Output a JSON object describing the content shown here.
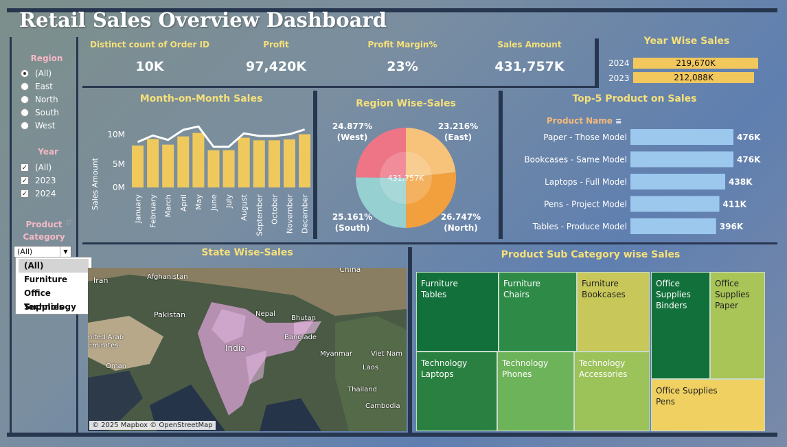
{
  "title": "Retail Sales Overview Dashboard",
  "filters": {
    "region": {
      "title": "Region",
      "options": [
        "(All)",
        "East",
        "North",
        "South",
        "West"
      ],
      "selected": "(All)"
    },
    "year": {
      "title": "Year",
      "options": [
        "(All)",
        "2023",
        "2024"
      ]
    },
    "product_category": {
      "title_line1": "Product",
      "title_line2": "Category",
      "value": "(All)",
      "options": [
        "(All)",
        "Furniture",
        "Office Supplies",
        "Technology"
      ]
    }
  },
  "kpis": [
    {
      "label": "Distinct count of Order ID",
      "value": "10K"
    },
    {
      "label": "Profit",
      "value": "97,420K"
    },
    {
      "label": "Profit Margin%",
      "value": "23%"
    },
    {
      "label": "Sales Amount",
      "value": "431,757K"
    }
  ],
  "year_wise_sales": {
    "title": "Year Wise Sales",
    "rows": [
      {
        "year": "2024",
        "label": "219,670K",
        "value": 219670
      },
      {
        "year": "2023",
        "label": "212,088K",
        "value": 212088
      }
    ]
  },
  "month_sales": {
    "title": "Month-on-Month Sales",
    "ylabel": "Sales Amount",
    "yticks": [
      "10M",
      "5M",
      "0M"
    ]
  },
  "region_sales": {
    "title": "Region Wise-Sales",
    "center": "431,757K",
    "labels": {
      "west_pct": "24.877%",
      "west": "(West)",
      "east_pct": "23.216%",
      "east": "(East)",
      "south_pct": "25.161%",
      "south": "(South)",
      "north_pct": "26.747%",
      "north": "(North)"
    }
  },
  "top5": {
    "title": "Top-5 Product on Sales",
    "header": "Product Name"
  },
  "state_sales": {
    "title": "State Wise-Sales",
    "credit": "© 2025 Mapbox © OpenStreetMap",
    "places": {
      "china": "China",
      "iran": "Iran",
      "afghanistan": "Afghanistan",
      "pakistan": "Pakistan",
      "nepal": "Nepal",
      "bhutan": "Bhutan",
      "india": "India",
      "bangladesh": "Banglade",
      "uae1": "nited Arab",
      "uae2": "Emirates",
      "oman": "Oman",
      "myanmar": "Myanmar",
      "laos": "Laos",
      "vietnam": "Viet Nam",
      "thailand": "Thailand",
      "cambodia": "Cambodia"
    }
  },
  "treemap": {
    "title": "Product Sub Category wise  Sales",
    "tiles": [
      {
        "line1": "Furniture",
        "line2": "Tables",
        "line3": ""
      },
      {
        "line1": "Furniture",
        "line2": "Chairs",
        "line3": ""
      },
      {
        "line1": "Furniture",
        "line2": "Bookcases",
        "line3": ""
      },
      {
        "line1": "Technology",
        "line2": "Laptops",
        "line3": ""
      },
      {
        "line1": "Technology",
        "line2": "Phones",
        "line3": ""
      },
      {
        "line1": "Technology",
        "line2": "Accessories",
        "line3": ""
      },
      {
        "line1": "Office",
        "line2": "Supplies",
        "line3": "Binders"
      },
      {
        "line1": "Office",
        "line2": "Supplies",
        "line3": "Paper"
      },
      {
        "line1": "Office Supplies",
        "line2": "Pens",
        "line3": ""
      }
    ],
    "colors": {
      "dark": "#12703a",
      "mid": "#2e8b47",
      "light": "#6db35a",
      "olive": "#a9c457",
      "yellow": "#f0d060"
    }
  },
  "chart_data": [
    {
      "type": "bar",
      "title": "Month-on-Month Sales",
      "ylabel": "Sales Amount",
      "ylim": [
        0,
        13
      ],
      "categories": [
        "January",
        "February",
        "March",
        "April",
        "May",
        "June",
        "July",
        "August",
        "September",
        "October",
        "November",
        "December"
      ],
      "values": [
        9.7,
        11.2,
        9.9,
        11.8,
        12.6,
        8.6,
        8.6,
        11.5,
        10.9,
        10.9,
        11.1,
        12.3
      ],
      "line": [
        10.5,
        12.0,
        11.0,
        13.3,
        14.1,
        9.4,
        9.4,
        12.5,
        11.9,
        11.9,
        12.3,
        13.4
      ]
    },
    {
      "type": "pie",
      "title": "Region Wise-Sales",
      "categories": [
        "East",
        "North",
        "South",
        "West"
      ],
      "values": [
        23.216,
        26.747,
        25.161,
        24.877
      ],
      "colors": [
        "#f7c27a",
        "#f2a03d",
        "#96d0d0",
        "#ee7585"
      ]
    },
    {
      "type": "bar",
      "title": "Top-5 Product on Sales",
      "categories": [
        "Paper - Those Model",
        "Bookcases - Same Model",
        "Laptops - Full Model",
        "Pens - Project Model",
        "Tables - Produce Model"
      ],
      "values": [
        476,
        476,
        438,
        411,
        396
      ],
      "labels": [
        "476K",
        "476K",
        "438K",
        "411K",
        "396K"
      ]
    }
  ]
}
